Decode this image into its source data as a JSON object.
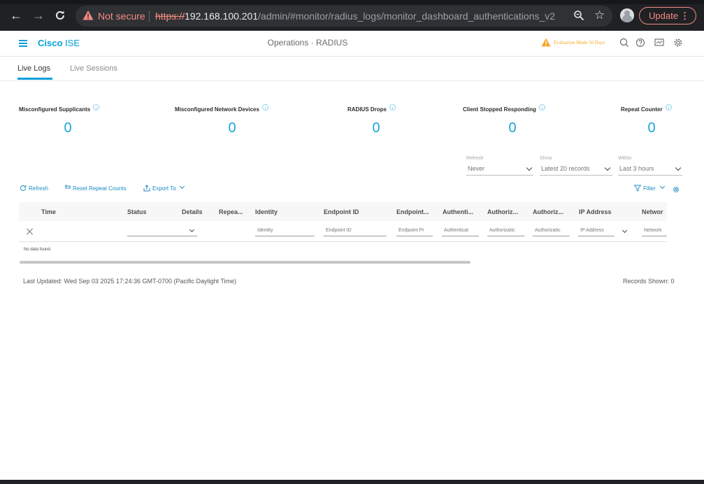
{
  "browser": {
    "security_label": "Not secure",
    "url_scheme": "https://",
    "url_host": "192.168.100.201",
    "url_path": "/admin/#monitor/radius_logs/monitor_dashboard_authentications_v2",
    "update_label": "Update"
  },
  "app": {
    "brand_bold": "Cisco",
    "brand_light": "ISE",
    "page_title": "Operations · RADIUS",
    "evaluation_notice": "Evaluation Mode 50 Days",
    "accent_color": "#049fd9",
    "warning_color": "#f5a623"
  },
  "tabs": [
    {
      "label": "Live Logs",
      "active": true
    },
    {
      "label": "Live Sessions",
      "active": false
    }
  ],
  "counters": [
    {
      "label": "Misconfigured Supplicants",
      "value": "0"
    },
    {
      "label": "Misconfigured Network Devices",
      "value": "0"
    },
    {
      "label": "RADIUS Drops",
      "value": "0"
    },
    {
      "label": "Client Stopped Responding",
      "value": "0"
    },
    {
      "label": "Repeat Counter",
      "value": "0"
    }
  ],
  "filters": {
    "refresh": {
      "label": "Refresh",
      "value": "Never"
    },
    "show": {
      "label": "Show",
      "value": "Latest 20 records"
    },
    "within": {
      "label": "Within",
      "value": "Last 3 hours"
    }
  },
  "toolbar": {
    "refresh": "Refresh",
    "reset_repeat_counts": "Reset Repeat Counts",
    "export_to": "Export To",
    "filter": "Filter"
  },
  "table": {
    "columns": [
      "Time",
      "Status",
      "Details",
      "Repea...",
      "Identity",
      "Endpoint ID",
      "Endpoint...",
      "Authenti...",
      "Authoriz...",
      "Authoriz...",
      "IP Address",
      "Networ"
    ],
    "filter_placeholders": {
      "identity": "Identity",
      "endpoint_id": "Endpoint ID",
      "endpoint_profile": "Endpoint Pr",
      "authentication": "Authenticat",
      "authorization_1": "Authorizatic",
      "authorization_2": "Authorizatic",
      "ip_address": "IP Address",
      "network": "Network"
    },
    "empty_message": "No data found."
  },
  "footer": {
    "last_updated": "Last Updated: Wed Sep 03 2025 17:24:36 GMT-0700 (Pacific Daylight Time)",
    "records_shown": "Records Shown: 0"
  }
}
